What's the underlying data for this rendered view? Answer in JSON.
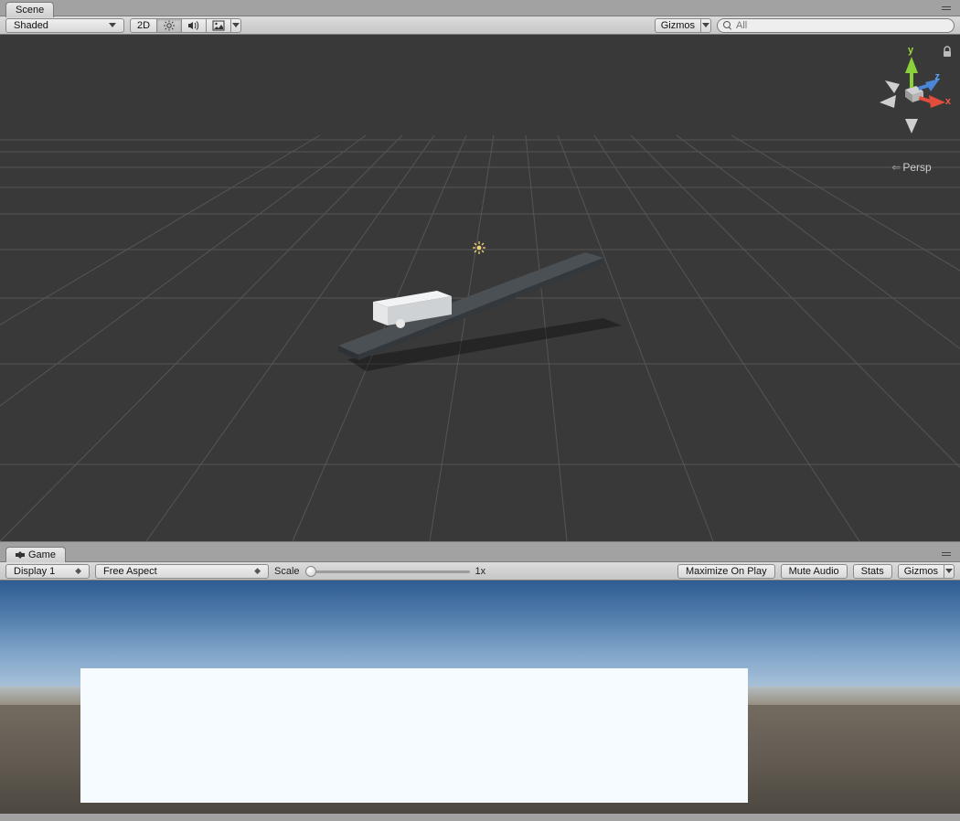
{
  "scene": {
    "tab_label": "Scene",
    "toolbar": {
      "shading_mode": "Shaded",
      "btn_2d": "2D",
      "gizmos_label": "Gizmos",
      "search_placeholder": "All",
      "icons": {
        "light": "sun-icon",
        "audio": "speaker-icon",
        "fx": "picture-icon"
      }
    },
    "gizmo": {
      "x": "x",
      "y": "y",
      "z": "z",
      "projection": "Persp"
    }
  },
  "game": {
    "tab_label": "Game",
    "toolbar": {
      "display": "Display 1",
      "aspect": "Free Aspect",
      "scale_label": "Scale",
      "scale_value": "1x",
      "maximize": "Maximize On Play",
      "mute": "Mute Audio",
      "stats": "Stats",
      "gizmos": "Gizmos"
    }
  }
}
